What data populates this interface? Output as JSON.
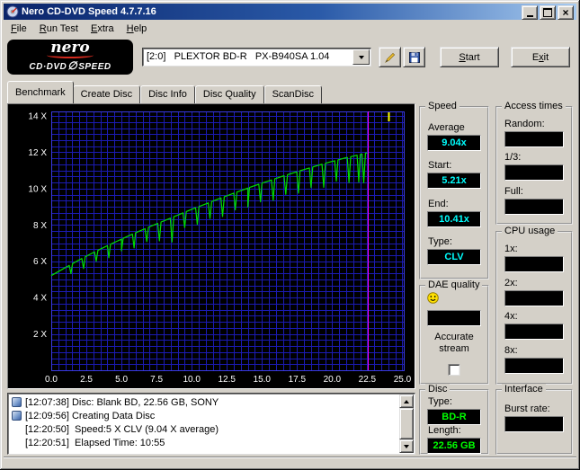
{
  "window": {
    "title": "Nero CD-DVD Speed 4.7.7.16"
  },
  "menu": {
    "items": [
      "File",
      "Run Test",
      "Extra",
      "Help"
    ]
  },
  "toolbar": {
    "logo": {
      "brand": "nero",
      "product": "CD·DVD",
      "slash": "∅",
      "speed": "SPEED"
    },
    "drive_select": {
      "value": "[2:0]   PLEXTOR BD-R   PX-B940SA 1.04"
    },
    "start_button": {
      "pre": "",
      "key": "S",
      "post": "tart"
    },
    "exit_button": {
      "pre": "E",
      "key": "x",
      "post": "it"
    }
  },
  "tabs": {
    "items": [
      {
        "label": "Benchmark",
        "active": true
      },
      {
        "label": "Create Disc",
        "active": false
      },
      {
        "label": "Disc Info",
        "active": false
      },
      {
        "label": "Disc Quality",
        "active": false
      },
      {
        "label": "ScanDisc",
        "active": false
      }
    ]
  },
  "chart_data": {
    "type": "line",
    "title": "",
    "xlabel": "",
    "ylabel": "",
    "xlim": [
      0,
      25.1
    ],
    "ylim": [
      0,
      14.25
    ],
    "x_ticks": [
      0,
      2.5,
      5,
      7.5,
      10,
      12.5,
      15,
      17.5,
      20,
      22.5,
      25
    ],
    "x_tick_labels": [
      "0.0",
      "2.5",
      "5.0",
      "7.5",
      "10.0",
      "12.5",
      "15.0",
      "17.5",
      "20.0",
      "22.5",
      "25.0"
    ],
    "y_ticks": [
      2,
      4,
      6,
      8,
      10,
      12,
      14
    ],
    "y_tick_labels": [
      "2 X",
      "4 X",
      "6 X",
      "8 X",
      "10 X",
      "12 X",
      "14 X"
    ],
    "grid": {
      "color": "#1b1bb4",
      "frame_color": "#3a3ae0",
      "x_step": 0.5,
      "y_step": 0.3333
    },
    "series": [
      {
        "name": "read-speed",
        "color": "#00dd00",
        "anchors": [
          [
            0,
            5.21
          ],
          [
            1,
            5.65
          ],
          [
            2,
            6.08
          ],
          [
            3,
            6.48
          ],
          [
            4,
            6.86
          ],
          [
            5,
            7.22
          ],
          [
            6,
            7.57
          ],
          [
            7,
            7.9
          ],
          [
            8,
            8.22
          ],
          [
            9,
            8.54
          ],
          [
            10,
            8.86
          ],
          [
            11,
            9.16
          ],
          [
            12,
            9.46
          ],
          [
            13,
            9.75
          ],
          [
            14,
            10.03
          ],
          [
            15,
            10.3
          ],
          [
            16,
            10.56
          ],
          [
            17,
            10.81
          ],
          [
            18,
            11.05
          ],
          [
            19,
            11.28
          ],
          [
            20,
            11.5
          ],
          [
            21,
            11.7
          ],
          [
            22,
            11.88
          ],
          [
            22.5,
            11.97
          ]
        ],
        "dips": [
          [
            1.4,
            0.5
          ],
          [
            2.3,
            0.6
          ],
          [
            3.2,
            0.55
          ],
          [
            4.1,
            0.7
          ],
          [
            5.0,
            0.65
          ],
          [
            5.9,
            0.8
          ],
          [
            6.8,
            0.75
          ],
          [
            7.7,
            1.0
          ],
          [
            8.6,
            1.35
          ],
          [
            9.5,
            0.85
          ],
          [
            10.4,
            0.95
          ],
          [
            11.3,
            0.9
          ],
          [
            12.2,
            1.05
          ],
          [
            13.1,
            0.95
          ],
          [
            14.0,
            1.05
          ],
          [
            14.9,
            1.0
          ],
          [
            15.8,
            1.15
          ],
          [
            16.7,
            1.05
          ],
          [
            17.6,
            1.2
          ],
          [
            18.5,
            1.1
          ],
          [
            19.4,
            1.3
          ],
          [
            20.3,
            1.15
          ],
          [
            21.2,
            1.4
          ],
          [
            21.9,
            1.5
          ],
          [
            22.25,
            1.6
          ]
        ]
      }
    ],
    "markers": {
      "end_line_x": 22.55,
      "end_line_color": "#ff00ff",
      "cap_tick_x": 24.0,
      "cap_tick_color": "#ffff00"
    }
  },
  "panels": {
    "speed": {
      "title": "Speed",
      "rows": [
        {
          "key": "average",
          "label": "Average",
          "value": "9.04x"
        },
        {
          "key": "start",
          "label": "Start:",
          "value": "5.21x"
        },
        {
          "key": "end",
          "label": "End:",
          "value": "10.41x"
        },
        {
          "key": "type",
          "label": "Type:",
          "value": "CLV"
        }
      ]
    },
    "access_times": {
      "title": "Access times",
      "rows": [
        {
          "key": "random",
          "label": "Random:",
          "value": ""
        },
        {
          "key": "one-third",
          "label": "1/3:",
          "value": ""
        },
        {
          "key": "full",
          "label": "Full:",
          "value": ""
        }
      ]
    },
    "cpu_usage": {
      "title": "CPU usage",
      "rows": [
        {
          "key": "1x",
          "label": "1x:",
          "value": ""
        },
        {
          "key": "2x",
          "label": "2x:",
          "value": ""
        },
        {
          "key": "4x",
          "label": "4x:",
          "value": ""
        },
        {
          "key": "8x",
          "label": "8x:",
          "value": ""
        }
      ]
    },
    "dae_quality": {
      "title": "DAE quality",
      "value": "",
      "accurate_label": "Accurate stream",
      "checkbox_checked": false
    },
    "disc": {
      "title": "Disc",
      "rows": [
        {
          "key": "type",
          "label": "Type:",
          "value": "BD-R"
        },
        {
          "key": "length",
          "label": "Length:",
          "value": "22.56 GB"
        }
      ]
    },
    "interface": {
      "title": "Interface",
      "rows": [
        {
          "key": "burst-rate",
          "label": "Burst rate:",
          "value": ""
        }
      ]
    }
  },
  "log": {
    "lines": [
      {
        "icon": true,
        "text": "[12:07:38] Disc: Blank BD, 22.56 GB, SONY"
      },
      {
        "icon": true,
        "text": "[12:09:56] Creating Data Disc"
      },
      {
        "icon": false,
        "text": "[12:20:50]  Speed:5 X CLV (9.04 X average)"
      },
      {
        "icon": false,
        "text": "[12:20:51]  Elapsed Time: 10:55"
      }
    ]
  },
  "colors": {
    "window_bg": "#d4d0c8",
    "titlebar_left": "#0a246a",
    "titlebar_right": "#a6caf0",
    "value_cyan": "#00ffff",
    "value_green": "#00ff00"
  }
}
